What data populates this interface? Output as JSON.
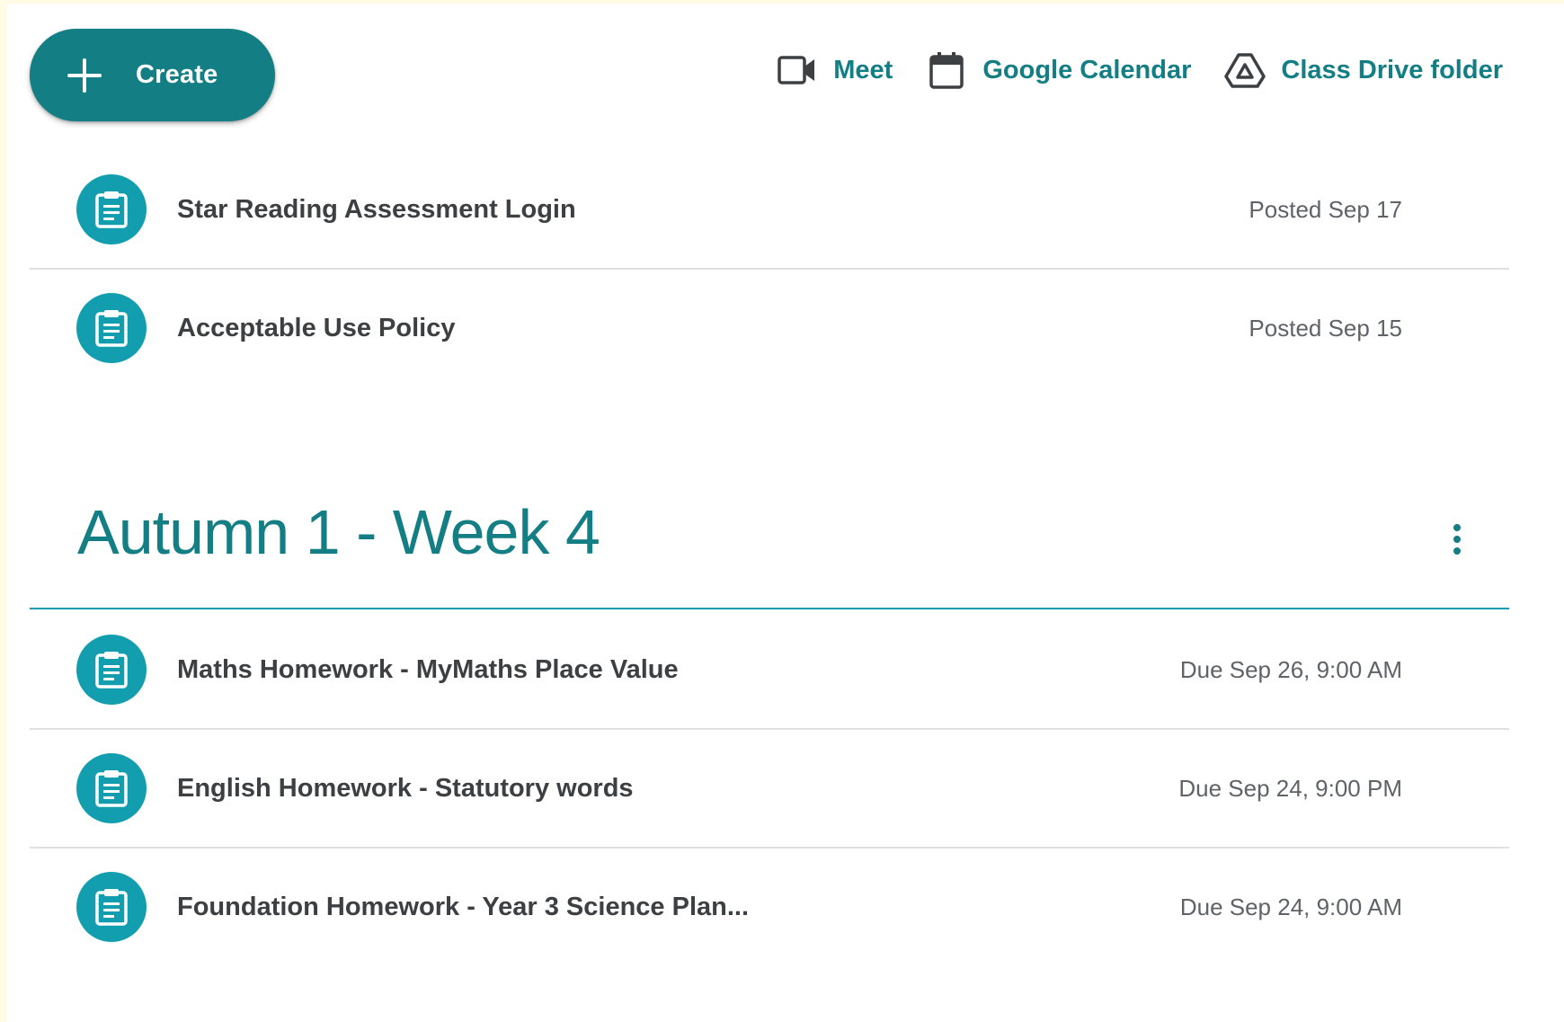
{
  "toolbar": {
    "create_label": "Create",
    "links": [
      {
        "label": "Meet",
        "icon": "video-camera-icon"
      },
      {
        "label": "Google Calendar",
        "icon": "calendar-icon"
      },
      {
        "label": "Class Drive folder",
        "icon": "drive-icon"
      }
    ]
  },
  "colors": {
    "accent": "#137e84",
    "icon_circle": "#129eaf",
    "title_text": "#3c4043",
    "meta_text": "#5f6368",
    "divider": "#e0e0e0"
  },
  "ungrouped_items": [
    {
      "title": "Star Reading Assessment Login",
      "date": "Posted Sep 17",
      "icon": "assignment-icon"
    },
    {
      "title": "Acceptable Use Policy",
      "date": "Posted Sep 15",
      "icon": "assignment-icon"
    }
  ],
  "topic": {
    "title": "Autumn 1 - Week 4",
    "more_icon": "more-vertical-icon",
    "items": [
      {
        "title": "Maths Homework - MyMaths Place Value",
        "date": "Due Sep 26, 9:00 AM",
        "icon": "assignment-icon"
      },
      {
        "title": "English Homework - Statutory words",
        "date": "Due Sep 24, 9:00 PM",
        "icon": "assignment-icon"
      },
      {
        "title": "Foundation Homework - Year 3 Science Plan...",
        "date": "Due Sep 24, 9:00 AM",
        "icon": "assignment-icon"
      }
    ]
  }
}
